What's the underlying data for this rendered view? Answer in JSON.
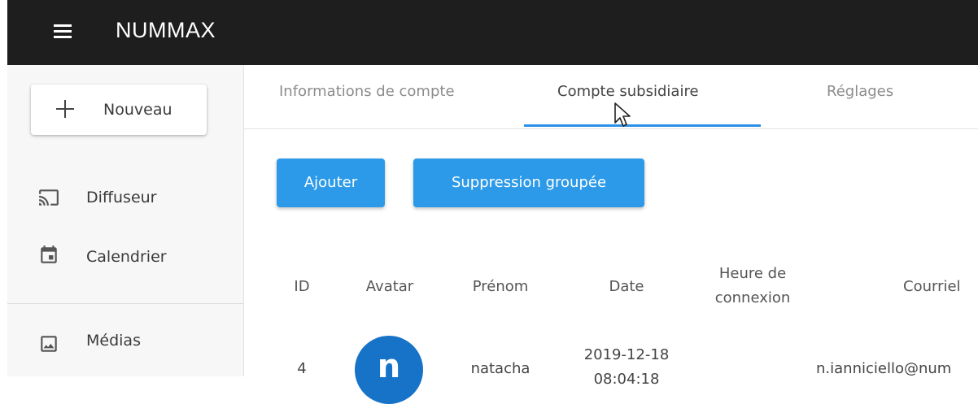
{
  "app": {
    "title": "NUMMAX"
  },
  "sidebar": {
    "new_button_label": "Nouveau",
    "items": [
      {
        "label": "Diffuseur",
        "icon": "cast-icon"
      },
      {
        "label": "Calendrier",
        "icon": "calendar-icon"
      },
      {
        "label": "Médias",
        "icon": "image-icon"
      }
    ]
  },
  "tabs": [
    {
      "label": "Informations de compte",
      "active": false
    },
    {
      "label": "Compte subsidiaire",
      "active": true
    },
    {
      "label": "Réglages",
      "active": false
    }
  ],
  "actions": {
    "add_label": "Ajouter",
    "bulk_delete_label": "Suppression groupée"
  },
  "table": {
    "headers": [
      "ID",
      "Avatar",
      "Prénom",
      "Date",
      "Heure de connexion",
      "Courriel"
    ],
    "rows": [
      {
        "id": "4",
        "avatar_letter": "n",
        "first_name": "natacha",
        "date_line1": "2019-12-18",
        "date_line2": "08:04:18",
        "login_time": "",
        "email": "n.ianniciello@num"
      }
    ]
  },
  "colors": {
    "accent": "#2c9ae8",
    "topbar": "#1e1e1e",
    "avatar": "#1673c7"
  }
}
